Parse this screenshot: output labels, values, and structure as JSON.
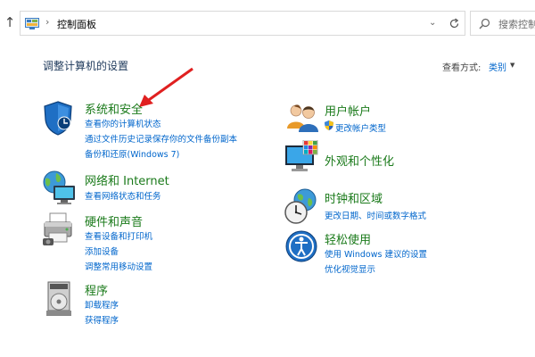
{
  "address_bar": {
    "path_separator": "›",
    "path": "控制面板",
    "search_placeholder": "搜索控制面板"
  },
  "header": {
    "title": "调整计算机的设置",
    "view_by_label": "查看方式:",
    "view_by_value": "类别"
  },
  "categories": [
    {
      "title": "系统和安全",
      "icon": "shield-icon",
      "links": [
        "查看你的计算机状态",
        "通过文件历史记录保存你的文件备份副本",
        "备份和还原(Windows 7)"
      ]
    },
    {
      "title": "网络和 Internet",
      "icon": "network-globe-icon",
      "links": [
        "查看网络状态和任务"
      ]
    },
    {
      "title": "硬件和声音",
      "icon": "printer-icon",
      "links": [
        "查看设备和打印机",
        "添加设备",
        "调整常用移动设置"
      ]
    },
    {
      "title": "程序",
      "icon": "programs-disk-icon",
      "links": [
        "卸载程序",
        "获得程序"
      ]
    },
    {
      "title": "用户帐户",
      "icon": "users-icon",
      "links": [
        "更改帐户类型"
      ]
    },
    {
      "title": "外观和个性化",
      "icon": "monitor-palette-icon",
      "links": []
    },
    {
      "title": "时钟和区域",
      "icon": "clock-globe-icon",
      "links": [
        "更改日期、时间或数字格式"
      ]
    },
    {
      "title": "轻松使用",
      "icon": "ease-of-access-icon",
      "links": [
        "使用 Windows 建议的设置",
        "优化视觉显示"
      ]
    }
  ],
  "colors": {
    "category_title": "#1a7a1a",
    "link": "#0066cc",
    "heading": "#1e395b",
    "annotation_arrow": "#e02020"
  }
}
